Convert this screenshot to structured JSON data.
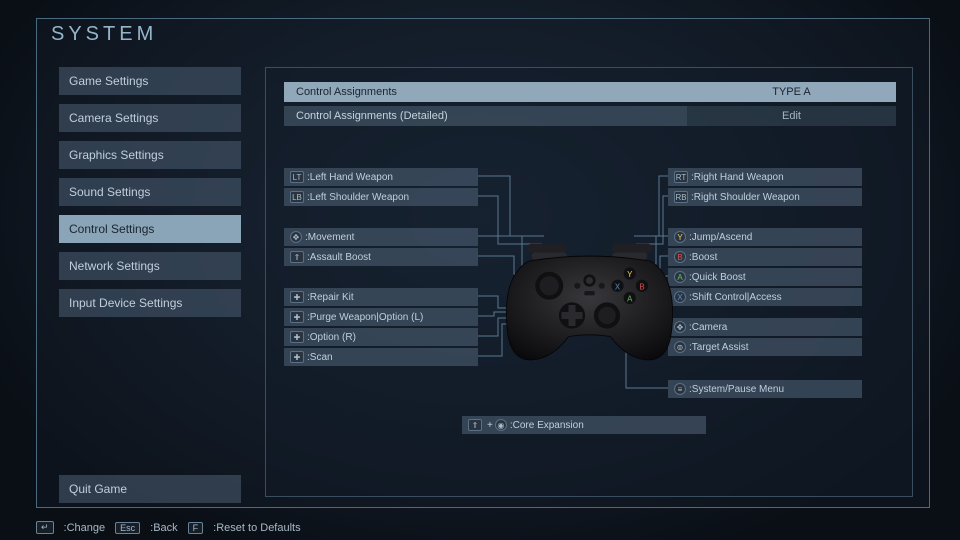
{
  "title": "SYSTEM",
  "sidebar": {
    "items": [
      {
        "label": "Game Settings"
      },
      {
        "label": "Camera Settings"
      },
      {
        "label": "Graphics Settings"
      },
      {
        "label": "Sound Settings"
      },
      {
        "label": "Control Settings",
        "selected": true
      },
      {
        "label": "Network Settings"
      },
      {
        "label": "Input Device Settings"
      }
    ],
    "quit": "Quit Game"
  },
  "options": {
    "row1": {
      "label": "Control Assignments",
      "value": "TYPE A"
    },
    "row2": {
      "label": "Control Assignments (Detailed)",
      "value": "Edit"
    }
  },
  "bindings": {
    "left": {
      "lt": {
        "icon": "LT",
        "label": ":Left Hand Weapon"
      },
      "lb": {
        "icon": "LB",
        "label": ":Left Shoulder Weapon"
      },
      "ls": {
        "icon": "✥",
        "label": ":Movement"
      },
      "l3": {
        "icon": "⇑",
        "label": ":Assault Boost"
      },
      "dpu": {
        "icon": "✚",
        "label": ":Repair Kit"
      },
      "dpl": {
        "icon": "✚",
        "label": ":Purge Weapon|Option (L)"
      },
      "dpr": {
        "icon": "✚",
        "label": ":Option (R)"
      },
      "dpd": {
        "icon": "✚",
        "label": ":Scan"
      }
    },
    "right": {
      "rt": {
        "icon": "RT",
        "label": ":Right Hand Weapon"
      },
      "rb": {
        "icon": "RB",
        "label": ":Right Shoulder Weapon"
      },
      "y": {
        "icon": "Y",
        "label": ":Jump/Ascend"
      },
      "b": {
        "icon": "B",
        "label": ":Boost"
      },
      "a": {
        "icon": "A",
        "label": ":Quick Boost"
      },
      "x": {
        "icon": "X",
        "label": ":Shift Control|Access"
      },
      "rs": {
        "icon": "✥",
        "label": ":Camera"
      },
      "r3": {
        "icon": "⊚",
        "label": ":Target Assist"
      },
      "menu": {
        "icon": "≡",
        "label": ":System/Pause Menu"
      }
    },
    "bottom": {
      "icon1": "⇑",
      "plus": "+",
      "icon2": "◉",
      "label": ":Core Expansion"
    }
  },
  "footer": {
    "change_key": "↵",
    "change": ":Change",
    "back_key": "Esc",
    "back": ":Back",
    "reset_key": "F",
    "reset": ":Reset to Defaults"
  }
}
